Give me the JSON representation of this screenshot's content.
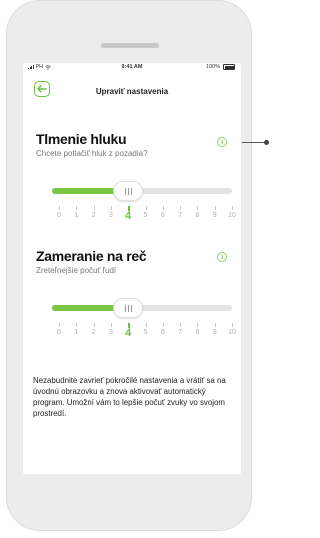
{
  "status_bar": {
    "carrier": "PH",
    "time": "9:41 AM",
    "battery": "100%"
  },
  "header": {
    "title": "Upraviť nastavenia",
    "back_icon": "arrow-left-icon"
  },
  "noise_reduction": {
    "title": "Tlmenie hluku",
    "subtitle": "Chcete potlačiť hluk z pozadia?",
    "info_glyph": "i",
    "value": 4,
    "min": 0,
    "max": 10,
    "scale": [
      "0",
      "1",
      "2",
      "3",
      "4",
      "5",
      "6",
      "7",
      "8",
      "9",
      "10"
    ]
  },
  "speech_focus": {
    "title": "Zameranie na reč",
    "subtitle": "Zreteľnejšie počuť ľudí",
    "info_glyph": "i",
    "value": 4,
    "min": 0,
    "max": 10,
    "scale": [
      "0",
      "1",
      "2",
      "3",
      "4",
      "5",
      "6",
      "7",
      "8",
      "9",
      "10"
    ]
  },
  "note": "Nezabudnite zavrieť pokročilé nastavenia a vrátiť sa na úvodnú obrazovku a znova aktivovať automatický program. Umožní vám to lepšie počuť zvuky vo svojom prostredí.",
  "colors": {
    "accent": "#7cc544",
    "accent_text": "#6abf3f"
  }
}
